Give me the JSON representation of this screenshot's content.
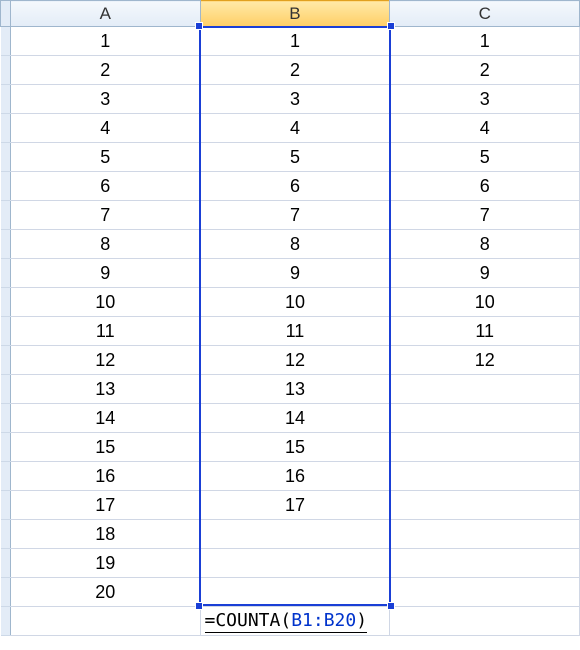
{
  "columns": [
    "A",
    "B",
    "C"
  ],
  "rows": [
    {
      "a": "1",
      "b": "1",
      "c": "1"
    },
    {
      "a": "2",
      "b": "2",
      "c": "2"
    },
    {
      "a": "3",
      "b": "3",
      "c": "3"
    },
    {
      "a": "4",
      "b": "4",
      "c": "4"
    },
    {
      "a": "5",
      "b": "5",
      "c": "5"
    },
    {
      "a": "6",
      "b": "6",
      "c": "6"
    },
    {
      "a": "7",
      "b": "7",
      "c": "7"
    },
    {
      "a": "8",
      "b": "8",
      "c": "8"
    },
    {
      "a": "9",
      "b": "9",
      "c": "9"
    },
    {
      "a": "10",
      "b": "10",
      "c": "10"
    },
    {
      "a": "11",
      "b": "11",
      "c": "11"
    },
    {
      "a": "12",
      "b": "12",
      "c": "12"
    },
    {
      "a": "13",
      "b": "13",
      "c": ""
    },
    {
      "a": "14",
      "b": "14",
      "c": ""
    },
    {
      "a": "15",
      "b": "15",
      "c": ""
    },
    {
      "a": "16",
      "b": "16",
      "c": ""
    },
    {
      "a": "17",
      "b": "17",
      "c": ""
    },
    {
      "a": "18",
      "b": "",
      "c": ""
    },
    {
      "a": "19",
      "b": "",
      "c": ""
    },
    {
      "a": "20",
      "b": "",
      "c": ""
    }
  ],
  "formula": {
    "prefix": "=COUNTA(",
    "ref": "B1:B20",
    "suffix": ")"
  },
  "selected_column_index": 1,
  "selection_range": "B1:B20"
}
